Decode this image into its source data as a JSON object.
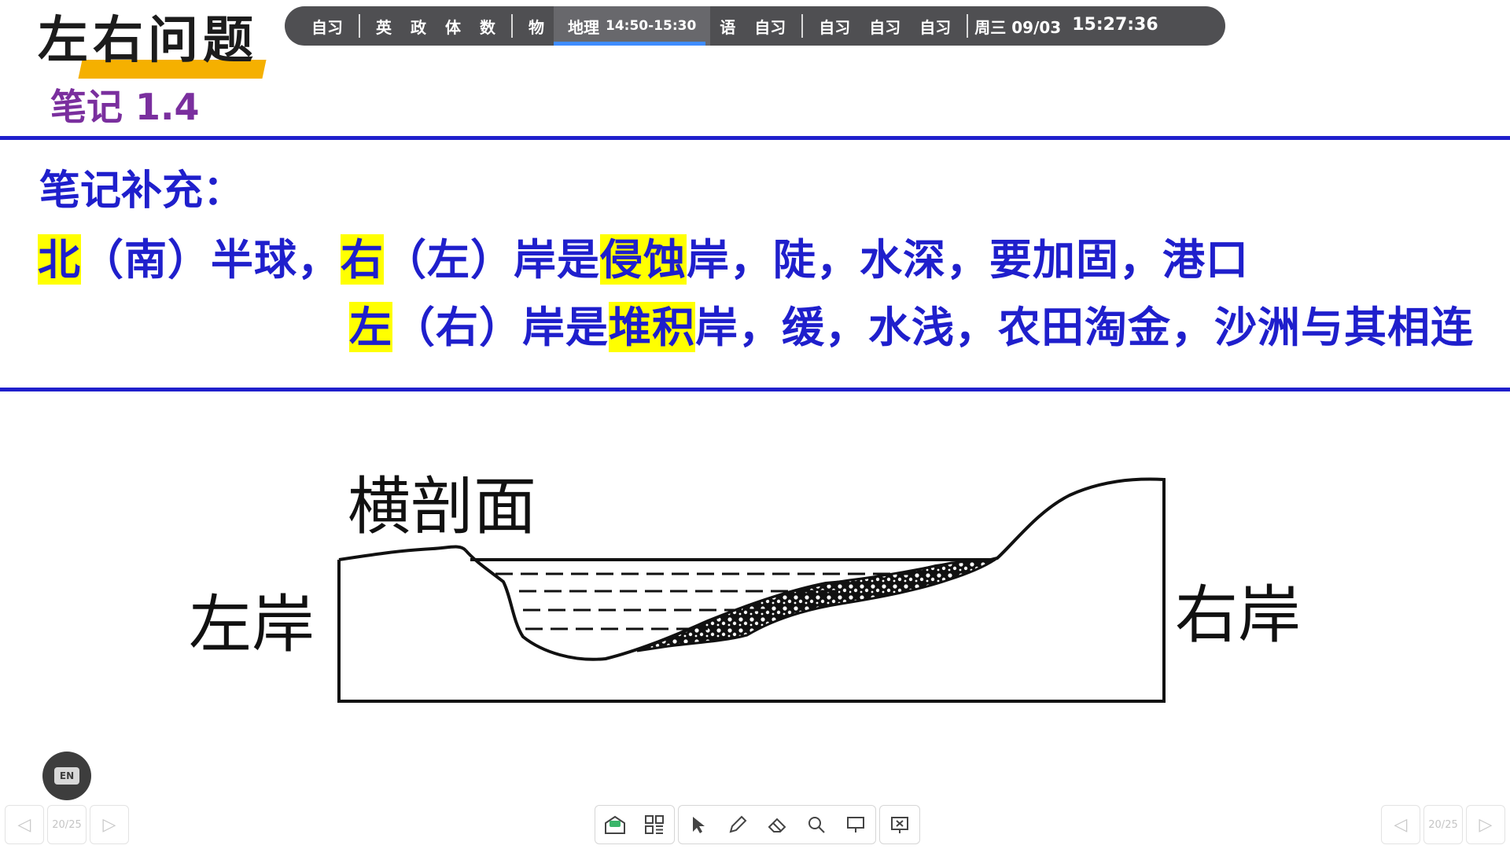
{
  "header": {
    "title": "左右问题",
    "subtitle": "笔记 1.4"
  },
  "schedule": {
    "items_a": [
      "自习"
    ],
    "items_b": [
      "英",
      "政",
      "体",
      "数"
    ],
    "items_c": [
      "物"
    ],
    "current": {
      "label": "地理",
      "time": "14:50-15:30"
    },
    "items_d": [
      "语",
      "自习"
    ],
    "items_e": [
      "自习",
      "自习",
      "自习"
    ],
    "day": "周三 09/03",
    "clock": "15:27:36"
  },
  "notes": {
    "heading": "笔记补充：",
    "line1": {
      "p1": "北",
      "p2": "（南）半球，",
      "p3": "右",
      "p4": "（左）岸是",
      "p5": "侵蚀",
      "p6": "岸，陡，水深，要加固，港口"
    },
    "line2": {
      "p1": "左",
      "p2": "（右）岸是",
      "p3": "堆积",
      "p4": "岸，缓，水浅，农田淘金，沙洲与其相连"
    }
  },
  "diagram": {
    "title": "横剖面",
    "left_bank": "左岸",
    "right_bank": "右岸"
  },
  "controls": {
    "lang_label": "EN",
    "page_left": "20/25",
    "page_right": "20/25",
    "prev_glyph": "◁",
    "next_glyph": "▷"
  },
  "colors": {
    "note_blue": "#1f1fcc",
    "highlight": "#ffff00",
    "title_bar": "#f5b000",
    "subtitle": "#7a2f9e",
    "schedule_bg": "#4f4f52",
    "current_indicator": "#3f8dff"
  }
}
